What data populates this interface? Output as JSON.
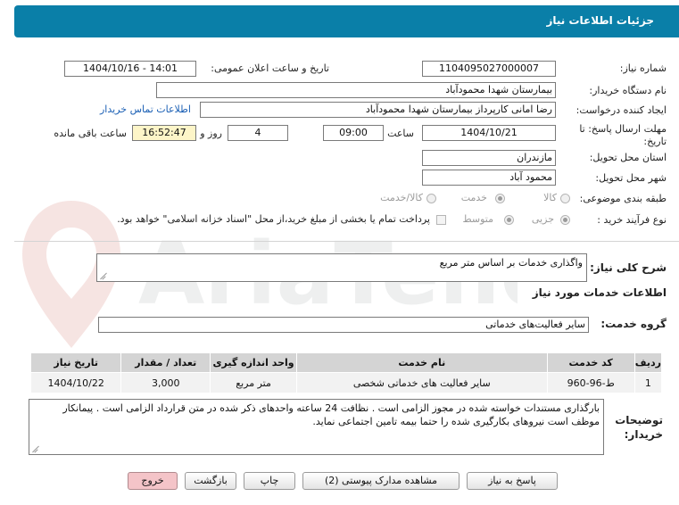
{
  "page": {
    "title": "جزئیات اطلاعات نیاز"
  },
  "fields": {
    "need_number": {
      "label": "شماره نیاز:",
      "value": "1104095027000007"
    },
    "announce_datetime": {
      "label": "تاریخ و ساعت اعلان عمومی:",
      "value": "1404/10/16 - 14:01"
    },
    "buyer_org": {
      "label": "نام دستگاه خریدار:",
      "value": "بیمارستان شهدا محمودآباد"
    },
    "requester": {
      "label": "ایجاد کننده درخواست:",
      "value": "رضا امانی کارپرداز بیمارستان شهدا محمودآباد"
    },
    "buyer_contact_link": "اطلاعات تماس خریدار",
    "deadline": {
      "label_line1": "مهلت ارسال پاسخ: تا",
      "label_line2": "تاریخ:",
      "date": "1404/10/21",
      "time_label": "ساعت",
      "time": "09:00",
      "days": "4",
      "days_label": "روز و",
      "remaining_time": "16:52:47",
      "remaining_label": "ساعت باقی مانده"
    },
    "province": {
      "label": "استان محل تحویل:",
      "value": "مازندران"
    },
    "city": {
      "label": "شهر محل تحویل:",
      "value": "محمود آباد"
    },
    "category": {
      "label": "طبقه بندی موضوعی:",
      "options": [
        "کالا",
        "خدمت",
        "کالا/خدمت"
      ],
      "selected": "خدمت"
    },
    "purchase_type": {
      "label": "نوع فرآیند خرید :",
      "options": [
        "جزیی",
        "متوسط"
      ],
      "selected": "جزیی",
      "checkbox_label": "پرداخت تمام یا بخشی از مبلغ خرید،از محل \"اسناد خزانه اسلامی\" خواهد بود."
    }
  },
  "summary": {
    "label": "شرح کلی نیاز:",
    "value": "واگذاری خدمات بر اساس متر مربع"
  },
  "services_info_title": "اطلاعات خدمات مورد نیاز",
  "service_group": {
    "label": "گروه خدمت:",
    "value": "سایر فعالیت‌های خدماتی"
  },
  "table": {
    "headers": [
      "ردیف",
      "کد خدمت",
      "نام خدمت",
      "واحد اندازه گیری",
      "تعداد / مقدار",
      "تاریخ نیاز"
    ],
    "rows": [
      [
        "1",
        "ط-96-960",
        "سایر فعالیت های خدماتی شخصی",
        "متر مربع",
        "3,000",
        "1404/10/22"
      ]
    ]
  },
  "buyer_notes": {
    "label_line1": "توضیحات",
    "label_line2": "خریدار:",
    "text": "بارگذاری مستندات خواسته شده در مجوز الزامی است . نظافت 24 ساعته واحدهای ذکر شده در متن قرارداد الزامی است . پیمانکار موظف است نیروهای بکارگیری شده را حتما بیمه تامین اجتماعی نماید."
  },
  "buttons": {
    "reply": "پاسخ به نیاز",
    "attachments": "مشاهده مدارک پیوستی (2)",
    "print": "چاپ",
    "back": "بازگشت",
    "exit": "خروج"
  },
  "watermark": "AriaTender.net",
  "colors": {
    "header": "#0a7fa8",
    "link": "#1a5fb4",
    "highlight": "#fdf5c8",
    "exit_button": "#f4c4c8"
  }
}
